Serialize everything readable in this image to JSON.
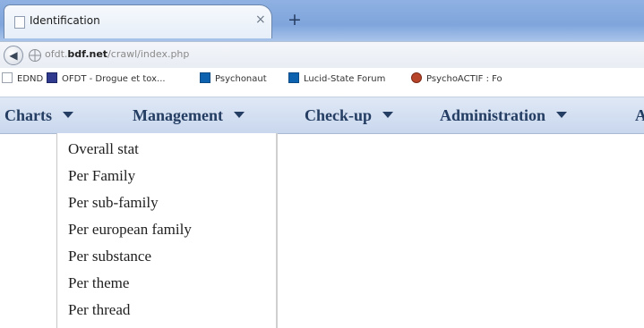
{
  "browser": {
    "tab": {
      "title": "Identification",
      "close": "×"
    },
    "new_tab": "+",
    "nav": {
      "back": "◀",
      "url_prefix": "ofdt.",
      "url_domain": "bdf.net",
      "url_path": "/crawl/index.php"
    },
    "bookmarks": [
      {
        "label": "EDND",
        "icon": "page-icon"
      },
      {
        "label": "OFDT - Drogue et tox...",
        "icon": "bookmark-card-icon"
      },
      {
        "label": "Psychonaut",
        "icon": "bookmark-mark-icon"
      },
      {
        "label": "Lucid-State Forum",
        "icon": "bookmark-mark-icon"
      },
      {
        "label": "PsychoACTIF : Fo",
        "icon": "owl-icon"
      }
    ]
  },
  "menu": {
    "items": [
      {
        "label": "Charts"
      },
      {
        "label": "Management"
      },
      {
        "label": "Check-up"
      },
      {
        "label": "Administration"
      },
      {
        "label": "A"
      }
    ]
  },
  "dropdown": {
    "items": [
      "Overall stat",
      "Per Family",
      "Per sub-family",
      "Per european family",
      "Per substance",
      "Per theme",
      "Per thread"
    ]
  }
}
